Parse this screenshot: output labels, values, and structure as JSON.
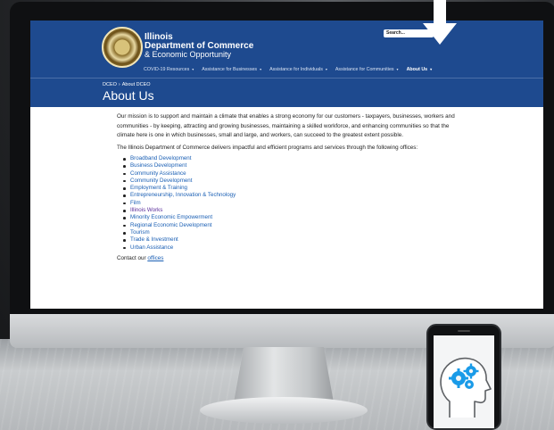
{
  "site": {
    "logo_lines": [
      "Illinois",
      "Department of Commerce",
      "& Economic Opportunity"
    ],
    "search_placeholder": "Search...",
    "nav": [
      {
        "label": "COVID-19 Resources",
        "active": false
      },
      {
        "label": "Assistance for Businesses",
        "active": false
      },
      {
        "label": "Assistance for Individuals",
        "active": false
      },
      {
        "label": "Assistance for Communities",
        "active": false
      },
      {
        "label": "About Us",
        "active": true
      }
    ]
  },
  "page": {
    "breadcrumb": [
      "DCEO",
      "About DCEO"
    ],
    "title": "About Us",
    "mission": "Our mission is to support and maintain a climate that enables a strong economy for our customers - taxpayers, businesses, workers and communities - by keeping, attracting and growing businesses, maintaining a skilled workforce, and enhancing communities so that the climate here is one in which businesses, small and large, and workers, can succeed to the greatest extent possible.",
    "intro": "The Illinois Department of Commerce delivers impactful and efficient programs and services through the following offices:",
    "offices": [
      "Broadband Development",
      "Business Development",
      "Community Assistance",
      "Community Development",
      "Employment & Training",
      "Entrepreneurship, Innovation & Technology",
      "Film",
      "Illinois Works",
      "Minority Economic Empowerment",
      "Regional Economic Development",
      "Tourism",
      "Trade & Investment",
      "Urban Assistance"
    ],
    "contact_prefix": "Contact our ",
    "contact_link": "offices"
  },
  "colors": {
    "header_blue": "#1e4a8f",
    "link_blue": "#1a5fb4",
    "visited_purple": "#5a2d9b"
  }
}
